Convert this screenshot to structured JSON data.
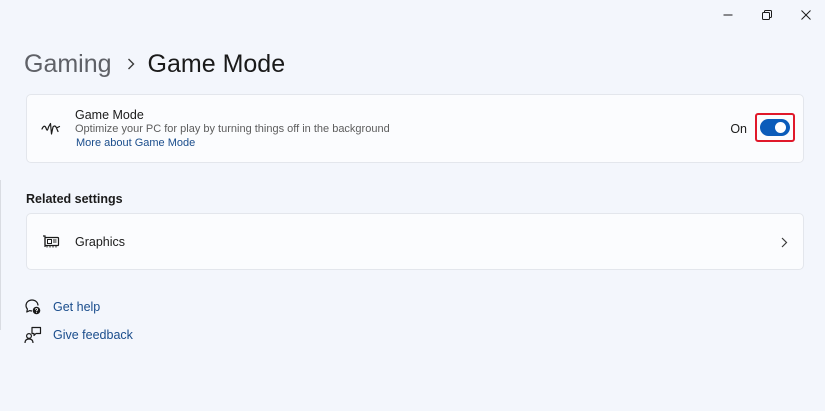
{
  "window": {
    "controls": [
      {
        "name": "minimize",
        "icon": "minimize-icon"
      },
      {
        "name": "restore",
        "icon": "restore-icon"
      },
      {
        "name": "close",
        "icon": "close-icon"
      }
    ]
  },
  "breadcrumb": {
    "parent": "Gaming",
    "separator_icon": "chevron-right-icon",
    "current": "Game Mode"
  },
  "game_mode_card": {
    "icon": "game-mode-icon",
    "title": "Game Mode",
    "description": "Optimize your PC for play by turning things off in the background",
    "link": "More about Game Mode",
    "toggle_state_label": "On",
    "toggle_on": true,
    "highlight_color": "#e0182a",
    "accent_color": "#0b5cba"
  },
  "related_settings": {
    "title": "Related settings",
    "items": [
      {
        "label": "Graphics",
        "icon": "graphics-card-icon",
        "chevron": "chevron-right-icon"
      }
    ]
  },
  "help": {
    "get_help": {
      "label": "Get help",
      "icon": "help-icon"
    },
    "give_feedback": {
      "label": "Give feedback",
      "icon": "feedback-icon"
    }
  }
}
